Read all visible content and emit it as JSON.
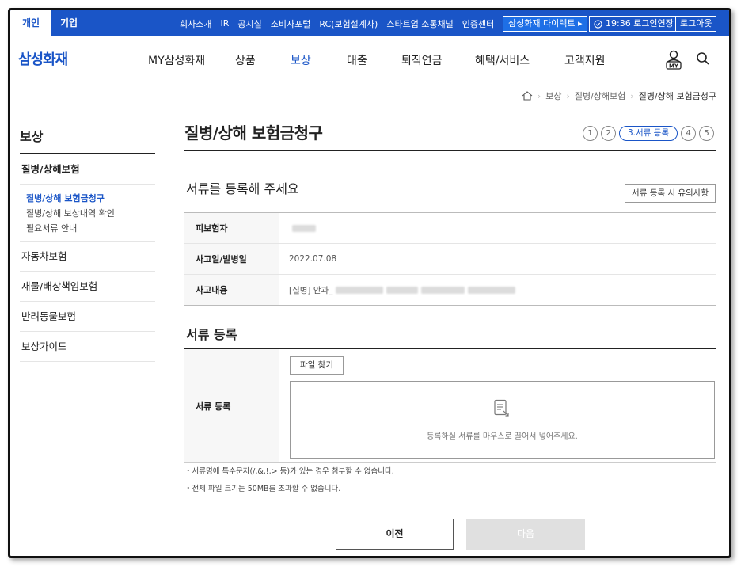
{
  "topbar": {
    "personal": "개인",
    "corporate": "기업",
    "links": [
      "회사소개",
      "IR",
      "공시실",
      "소비자포털",
      "RC(보험설계사)",
      "스타트업 소통채널",
      "인증센터"
    ],
    "direct": "삼성화재 다이렉트 ▸",
    "session": "19:36 로그인연장",
    "logout": "로그아웃"
  },
  "gnb": {
    "logo": "삼성화재",
    "menu": [
      "MY삼성화재",
      "상품",
      "보상",
      "대출",
      "퇴직연금",
      "혜택/서비스",
      "고객지원"
    ],
    "active_index": 2,
    "my_label": "MY"
  },
  "breadcrumb": [
    "보상",
    "질병/상해보험",
    "질병/상해 보험금청구"
  ],
  "sidebar": {
    "title": "보상",
    "open_category": "질병/상해보험",
    "sub_items": [
      "질병/상해 보험금청구",
      "질병/상해 보상내역 확인",
      "필요서류 안내"
    ],
    "active_sub": 0,
    "categories": [
      "자동차보험",
      "재물/배상책임보험",
      "반려동물보험",
      "보상가이드"
    ]
  },
  "main": {
    "title": "질병/상해 보험금청구",
    "steps": [
      "1",
      "2",
      "3.서류 등록",
      "4",
      "5"
    ],
    "current_step_index": 2,
    "section1_title": "서류를 등록해 주세요",
    "caution_button": "서류 등록 시 유의사항",
    "info_rows": [
      {
        "key": "피보험자",
        "value": ""
      },
      {
        "key": "사고일/발병일",
        "value": "2022.07.08"
      },
      {
        "key": "사고내용",
        "value": "[질병] 안과_"
      }
    ],
    "section2_title": "서류 등록",
    "upload_key": "서류 등록",
    "file_button": "파일 찾기",
    "drop_text": "등록하실 서류를 마우스로 끌어서 넣어주세요.",
    "notes": [
      "・서류명에 특수문자(/,&,!,> 등)가 있는 경우 첨부할 수 없습니다.",
      "・전체 파일 크기는 50MB를 초과할 수 없습니다."
    ],
    "prev_button": "이전",
    "next_button": "다음"
  },
  "colors": {
    "brand_blue": "#1a55c7",
    "disabled_gray": "#e0e0e0"
  }
}
